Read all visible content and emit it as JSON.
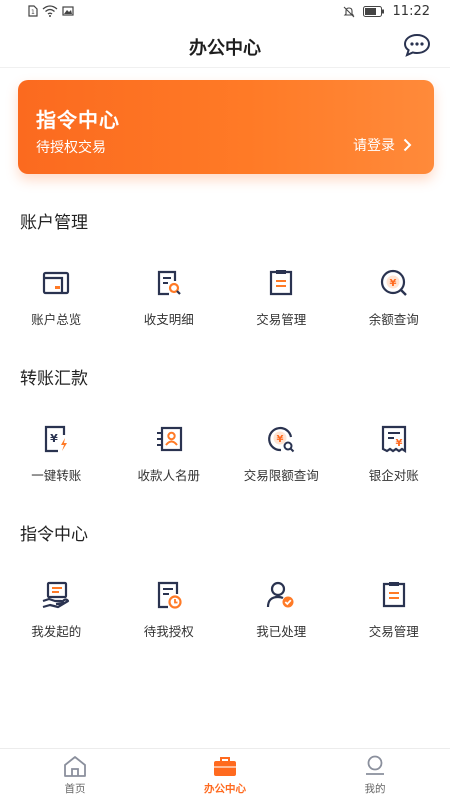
{
  "status_bar": {
    "time": "11:22"
  },
  "header": {
    "title": "办公中心"
  },
  "banner": {
    "title": "指令中心",
    "subtitle": "待授权交易",
    "login_label": "请登录"
  },
  "sections": [
    {
      "title": "账户管理",
      "items": [
        {
          "label": "账户总览",
          "icon": "account-overview-icon"
        },
        {
          "label": "收支明细",
          "icon": "income-expense-icon"
        },
        {
          "label": "交易管理",
          "icon": "transaction-manage-icon"
        },
        {
          "label": "余额查询",
          "icon": "balance-query-icon"
        }
      ]
    },
    {
      "title": "转账汇款",
      "items": [
        {
          "label": "一键转账",
          "icon": "quick-transfer-icon"
        },
        {
          "label": "收款人名册",
          "icon": "payee-list-icon"
        },
        {
          "label": "交易限额查询",
          "icon": "limit-query-icon"
        },
        {
          "label": "银企对账",
          "icon": "reconciliation-icon"
        }
      ]
    },
    {
      "title": "指令中心",
      "items": [
        {
          "label": "我发起的",
          "icon": "initiated-icon"
        },
        {
          "label": "待我授权",
          "icon": "pending-auth-icon"
        },
        {
          "label": "我已处理",
          "icon": "processed-icon"
        },
        {
          "label": "交易管理",
          "icon": "transaction-manage-icon"
        }
      ]
    }
  ],
  "tab_bar": {
    "tabs": [
      {
        "label": "首页",
        "icon": "home-icon",
        "active": false
      },
      {
        "label": "办公中心",
        "icon": "briefcase-icon",
        "active": true
      },
      {
        "label": "我的",
        "icon": "profile-icon",
        "active": false
      }
    ]
  },
  "colors": {
    "accent": "#ff6a1f",
    "icon_dark": "#2a3350",
    "icon_orange": "#ff7a26"
  }
}
